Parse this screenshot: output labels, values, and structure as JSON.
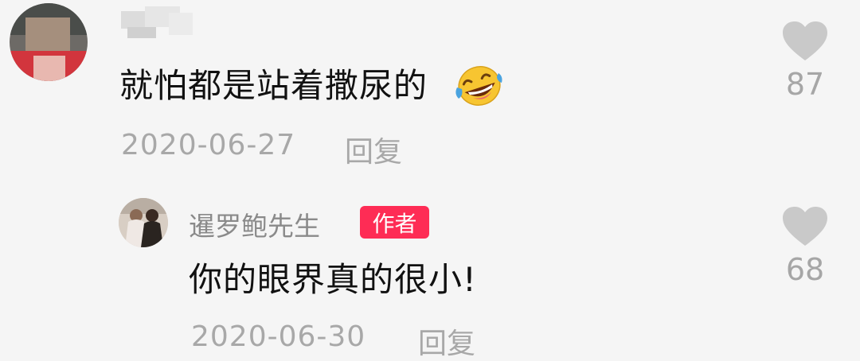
{
  "comment": {
    "text": "就怕都是站着撒尿的",
    "emoji": "rofl-emoji",
    "date": "2020-06-27",
    "reply_label": "回复",
    "likes": "87"
  },
  "reply": {
    "username": "暹罗鲍先生",
    "badge": "作者",
    "text": "你的眼界真的很小!",
    "date": "2020-06-30",
    "reply_label": "回复",
    "likes": "68"
  },
  "colors": {
    "badge": "#fe2c55",
    "meta_text": "#a8a8a8",
    "heart": "#c9c9c9"
  }
}
